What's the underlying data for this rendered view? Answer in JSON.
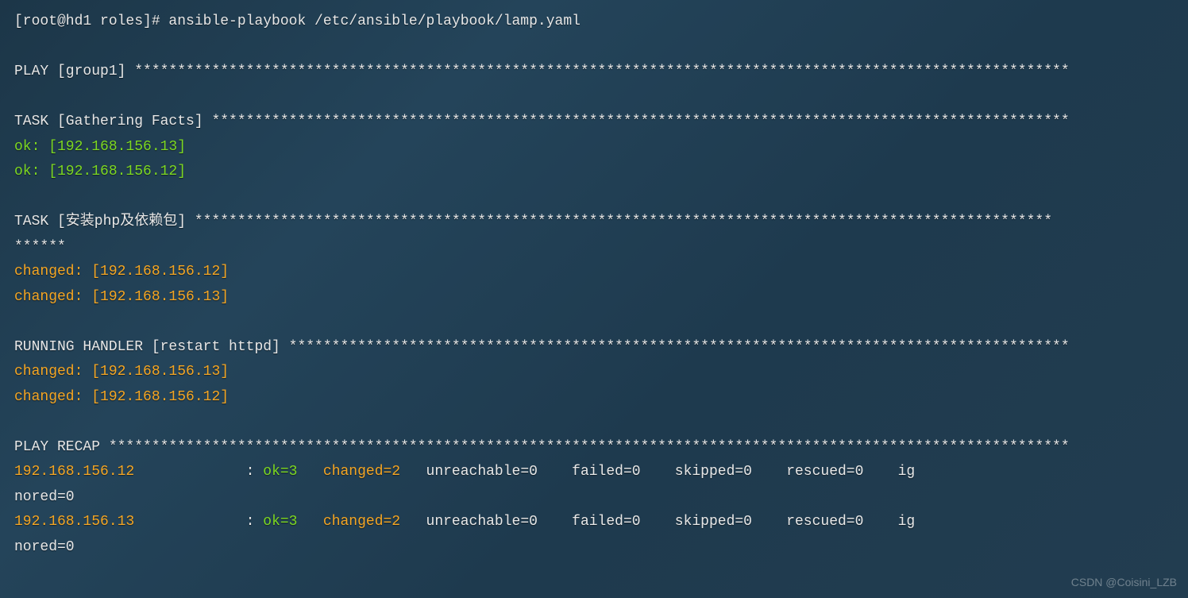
{
  "prompt": "[root@hd1 roles]# ansible-playbook /etc/ansible/playbook/lamp.yaml",
  "play_header": "PLAY [group1] *************************************************************************************************************",
  "task_gathering_header": "TASK [Gathering Facts] ****************************************************************************************************",
  "gathering_ok1": "ok: [192.168.156.13]",
  "gathering_ok2": "ok: [192.168.156.12]",
  "task_php_header": "TASK [安装php及依赖包] ****************************************************************************************************",
  "task_php_overflow": "******",
  "php_changed1": "changed: [192.168.156.12]",
  "php_changed2": "changed: [192.168.156.13]",
  "handler_header": "RUNNING HANDLER [restart httpd] *******************************************************************************************",
  "handler_changed1": "changed: [192.168.156.13]",
  "handler_changed2": "changed: [192.168.156.12]",
  "recap_header": "PLAY RECAP ****************************************************************************************************************",
  "recap1_host": "192.168.156.12",
  "recap1_colon": "             : ",
  "recap1_ok": "ok=3   ",
  "recap1_changed": "changed=2   ",
  "recap1_rest": "unreachable=0    failed=0    skipped=0    rescued=0    ig",
  "recap1_wrap": "nored=0",
  "recap2_host": "192.168.156.13",
  "recap2_colon": "             : ",
  "recap2_ok": "ok=3   ",
  "recap2_changed": "changed=2   ",
  "recap2_rest": "unreachable=0    failed=0    skipped=0    rescued=0    ig",
  "recap2_wrap": "nored=0",
  "watermark": "CSDN @Coisini_LZB"
}
